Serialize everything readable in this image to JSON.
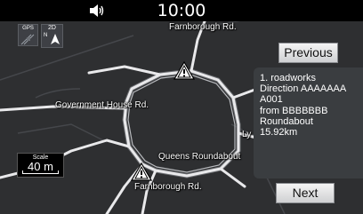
{
  "status_bar": {
    "time": "10:00",
    "volume_icon": "speaker-icon"
  },
  "map": {
    "gps_label": "GPS",
    "view_mode": "2D",
    "north_label": "N",
    "roads": {
      "farnborough_top": "Farnborough Rd.",
      "government_house": "Government House Rd.",
      "queens_roundabout": "Queens Roundabout",
      "farnborough_bottom": "Farnborough Rd.",
      "partial_right": "Ly"
    },
    "scale": {
      "caption": "Scale",
      "value": "40 m"
    },
    "icons": [
      "roadworks-warning-icon",
      "roadworks-warning-icon",
      "compass-arrow-icon"
    ]
  },
  "controls": {
    "previous_label": "Previous",
    "next_label": "Next"
  },
  "info": {
    "line1": "1. roadworks",
    "line2": "Direction AAAAAAA",
    "line3": "A001",
    "line4": "from BBBBBBB",
    "line5": "Roundabout",
    "line6": "15.92km"
  },
  "colors": {
    "map_bg": "#2e2f31",
    "road": "#e8e8ea",
    "route": "#8e9096",
    "panel_bg": "#3a3d40",
    "button_bg": "#e2e3e5"
  }
}
